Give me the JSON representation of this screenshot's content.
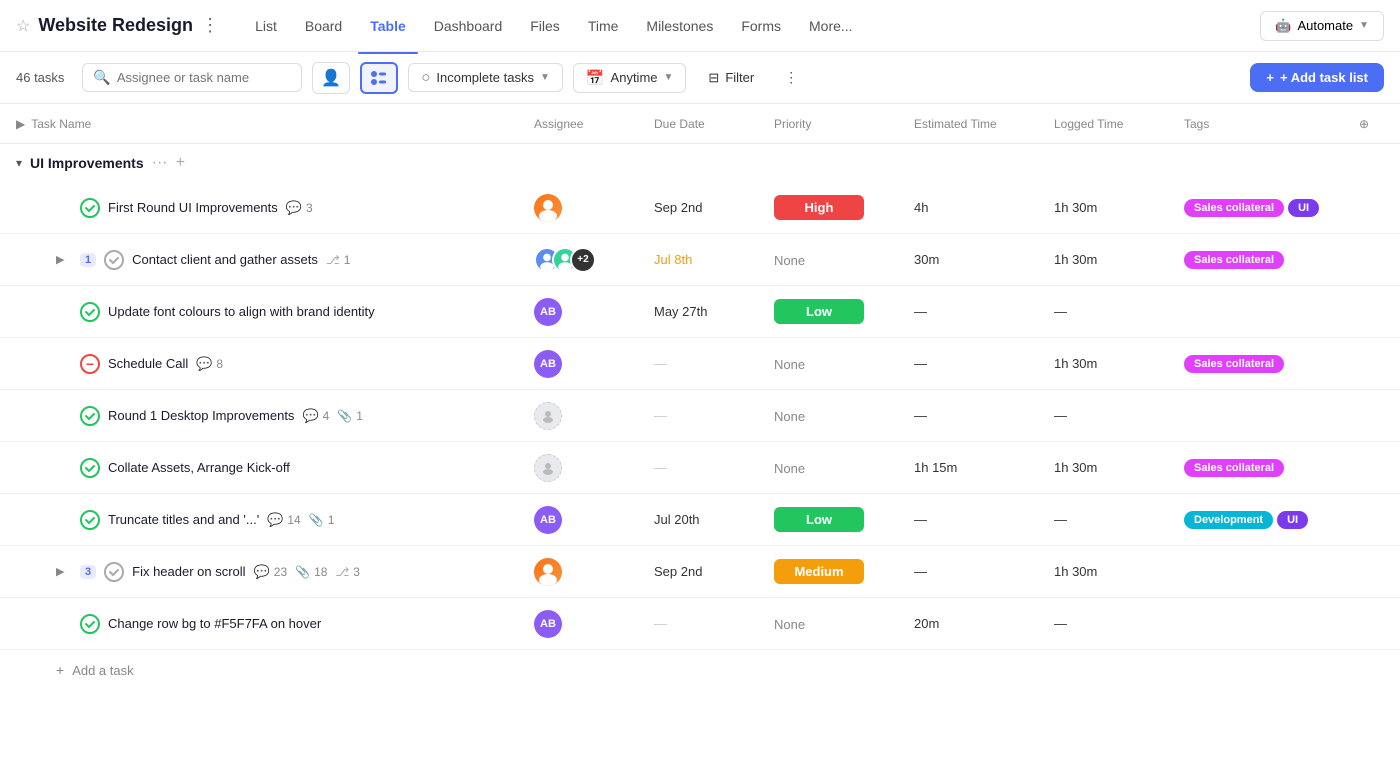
{
  "header": {
    "star": "☆",
    "title": "Website Redesign",
    "more": "⋮",
    "tabs": [
      {
        "label": "List",
        "active": false
      },
      {
        "label": "Board",
        "active": false
      },
      {
        "label": "Table",
        "active": true
      },
      {
        "label": "Dashboard",
        "active": false
      },
      {
        "label": "Files",
        "active": false
      },
      {
        "label": "Time",
        "active": false
      },
      {
        "label": "Milestones",
        "active": false
      },
      {
        "label": "Forms",
        "active": false
      },
      {
        "label": "More...",
        "active": false
      }
    ],
    "automate_label": "Automate",
    "automate_icon": "🤖"
  },
  "toolbar": {
    "task_count": "46 tasks",
    "search_placeholder": "Assignee or task name",
    "incomplete_tasks_label": "Incomplete tasks",
    "anytime_label": "Anytime",
    "filter_label": "Filter",
    "add_task_list_label": "+ Add task list"
  },
  "table": {
    "columns": [
      "Task Name",
      "Assignee",
      "Due Date",
      "Priority",
      "Estimated Time",
      "Logged Time",
      "Tags"
    ],
    "expand_all_icon": "▶",
    "add_col_icon": "⊕",
    "section_name": "UI Improvements",
    "section_dots": "···",
    "section_add": "+",
    "rows": [
      {
        "id": 1,
        "indent": 1,
        "status": "done",
        "expandable": false,
        "badge": null,
        "name": "First Round UI Improvements",
        "comment_icon": "💬",
        "comment_count": "3",
        "attach_icon": null,
        "attach_count": null,
        "subtask_icon": null,
        "subtask_count": null,
        "assignee_type": "avatar",
        "assignee_color": "#f97316",
        "assignee_initials": "",
        "assignee_img": true,
        "assignee_img_color": "#f97316",
        "due_date": "Sep 2nd",
        "due_overdue": false,
        "priority": "High",
        "priority_type": "high",
        "estimated": "4h",
        "logged": "1h 30m",
        "tags": [
          "Sales collateral",
          "UI"
        ]
      },
      {
        "id": 2,
        "indent": 1,
        "status": "pending",
        "expandable": true,
        "badge": "1",
        "name": "Contact client and gather assets",
        "comment_icon": null,
        "comment_count": null,
        "attach_icon": null,
        "attach_count": null,
        "subtask_icon": "⎇",
        "subtask_count": "1",
        "assignee_type": "multi",
        "due_date": "Jul 8th",
        "due_overdue": true,
        "priority": "None",
        "priority_type": "none",
        "estimated": "30m",
        "logged": "1h 30m",
        "tags": [
          "Sales collateral"
        ]
      },
      {
        "id": 3,
        "indent": 1,
        "status": "done",
        "expandable": false,
        "badge": null,
        "name": "Update font colours to align with brand identity",
        "comment_icon": null,
        "comment_count": null,
        "attach_icon": null,
        "attach_count": null,
        "subtask_icon": null,
        "subtask_count": null,
        "assignee_type": "initials",
        "assignee_color": "#8b5cf6",
        "assignee_initials": "AB",
        "due_date": "May 27th",
        "due_overdue": false,
        "priority": "Low",
        "priority_type": "low",
        "estimated": "—",
        "logged": "—",
        "tags": []
      },
      {
        "id": 4,
        "indent": 1,
        "status": "blocked",
        "expandable": false,
        "badge": null,
        "name": "Schedule Call",
        "comment_icon": "💬",
        "comment_count": "8",
        "attach_icon": null,
        "attach_count": null,
        "subtask_icon": null,
        "subtask_count": null,
        "assignee_type": "initials",
        "assignee_color": "#8b5cf6",
        "assignee_initials": "AB",
        "due_date": "—",
        "due_overdue": false,
        "priority": "None",
        "priority_type": "none",
        "estimated": "—",
        "logged": "1h 30m",
        "tags": [
          "Sales collateral"
        ]
      },
      {
        "id": 5,
        "indent": 1,
        "status": "done",
        "expandable": false,
        "badge": null,
        "name": "Round 1 Desktop Improvements",
        "comment_icon": "💬",
        "comment_count": "4",
        "attach_icon": "📎",
        "attach_count": "1",
        "subtask_icon": null,
        "subtask_count": null,
        "assignee_type": "placeholder",
        "due_date": "—",
        "due_overdue": false,
        "priority": "None",
        "priority_type": "none",
        "estimated": "—",
        "logged": "—",
        "tags": []
      },
      {
        "id": 6,
        "indent": 1,
        "status": "done",
        "expandable": false,
        "badge": null,
        "name": "Collate Assets, Arrange Kick-off",
        "comment_icon": null,
        "comment_count": null,
        "attach_icon": null,
        "attach_count": null,
        "subtask_icon": null,
        "subtask_count": null,
        "assignee_type": "placeholder",
        "due_date": "—",
        "due_overdue": false,
        "priority": "None",
        "priority_type": "none",
        "estimated": "1h 15m",
        "logged": "1h 30m",
        "tags": [
          "Sales collateral"
        ]
      },
      {
        "id": 7,
        "indent": 1,
        "status": "done",
        "expandable": false,
        "badge": null,
        "name": "Truncate titles and and '...'",
        "comment_icon": "💬",
        "comment_count": "14",
        "attach_icon": "📎",
        "attach_count": "1",
        "subtask_icon": null,
        "subtask_count": null,
        "assignee_type": "initials",
        "assignee_color": "#8b5cf6",
        "assignee_initials": "AB",
        "due_date": "Jul 20th",
        "due_overdue": false,
        "priority": "Low",
        "priority_type": "low",
        "estimated": "—",
        "logged": "—",
        "tags": [
          "Development",
          "UI"
        ]
      },
      {
        "id": 8,
        "indent": 1,
        "status": "pending",
        "expandable": true,
        "badge": "3",
        "name": "Fix header on scroll",
        "comment_icon": "💬",
        "comment_count": "23",
        "attach_icon": "📎",
        "attach_count": "18",
        "subtask_icon": "⎇",
        "subtask_count": "3",
        "assignee_type": "avatar",
        "assignee_color": "#f97316",
        "assignee_img": true,
        "due_date": "Sep 2nd",
        "due_overdue": false,
        "priority": "Medium",
        "priority_type": "medium",
        "estimated": "—",
        "logged": "1h 30m",
        "tags": []
      },
      {
        "id": 9,
        "indent": 1,
        "status": "done",
        "expandable": false,
        "badge": null,
        "name": "Change row bg to #F5F7FA on hover",
        "comment_icon": null,
        "comment_count": null,
        "attach_icon": null,
        "attach_count": null,
        "subtask_icon": null,
        "subtask_count": null,
        "assignee_type": "initials",
        "assignee_color": "#8b5cf6",
        "assignee_initials": "AB",
        "due_date": "—",
        "due_overdue": false,
        "priority": "None",
        "priority_type": "none",
        "estimated": "20m",
        "logged": "—",
        "tags": []
      }
    ],
    "add_task_label": "Add a task"
  },
  "colors": {
    "accent": "#4c6ef5",
    "high": "#ef4444",
    "low": "#22c55e",
    "medium": "#f59e0b",
    "sales_tag": "#e040fb",
    "ui_tag": "#7c3aed",
    "dev_tag": "#06b6d4"
  }
}
